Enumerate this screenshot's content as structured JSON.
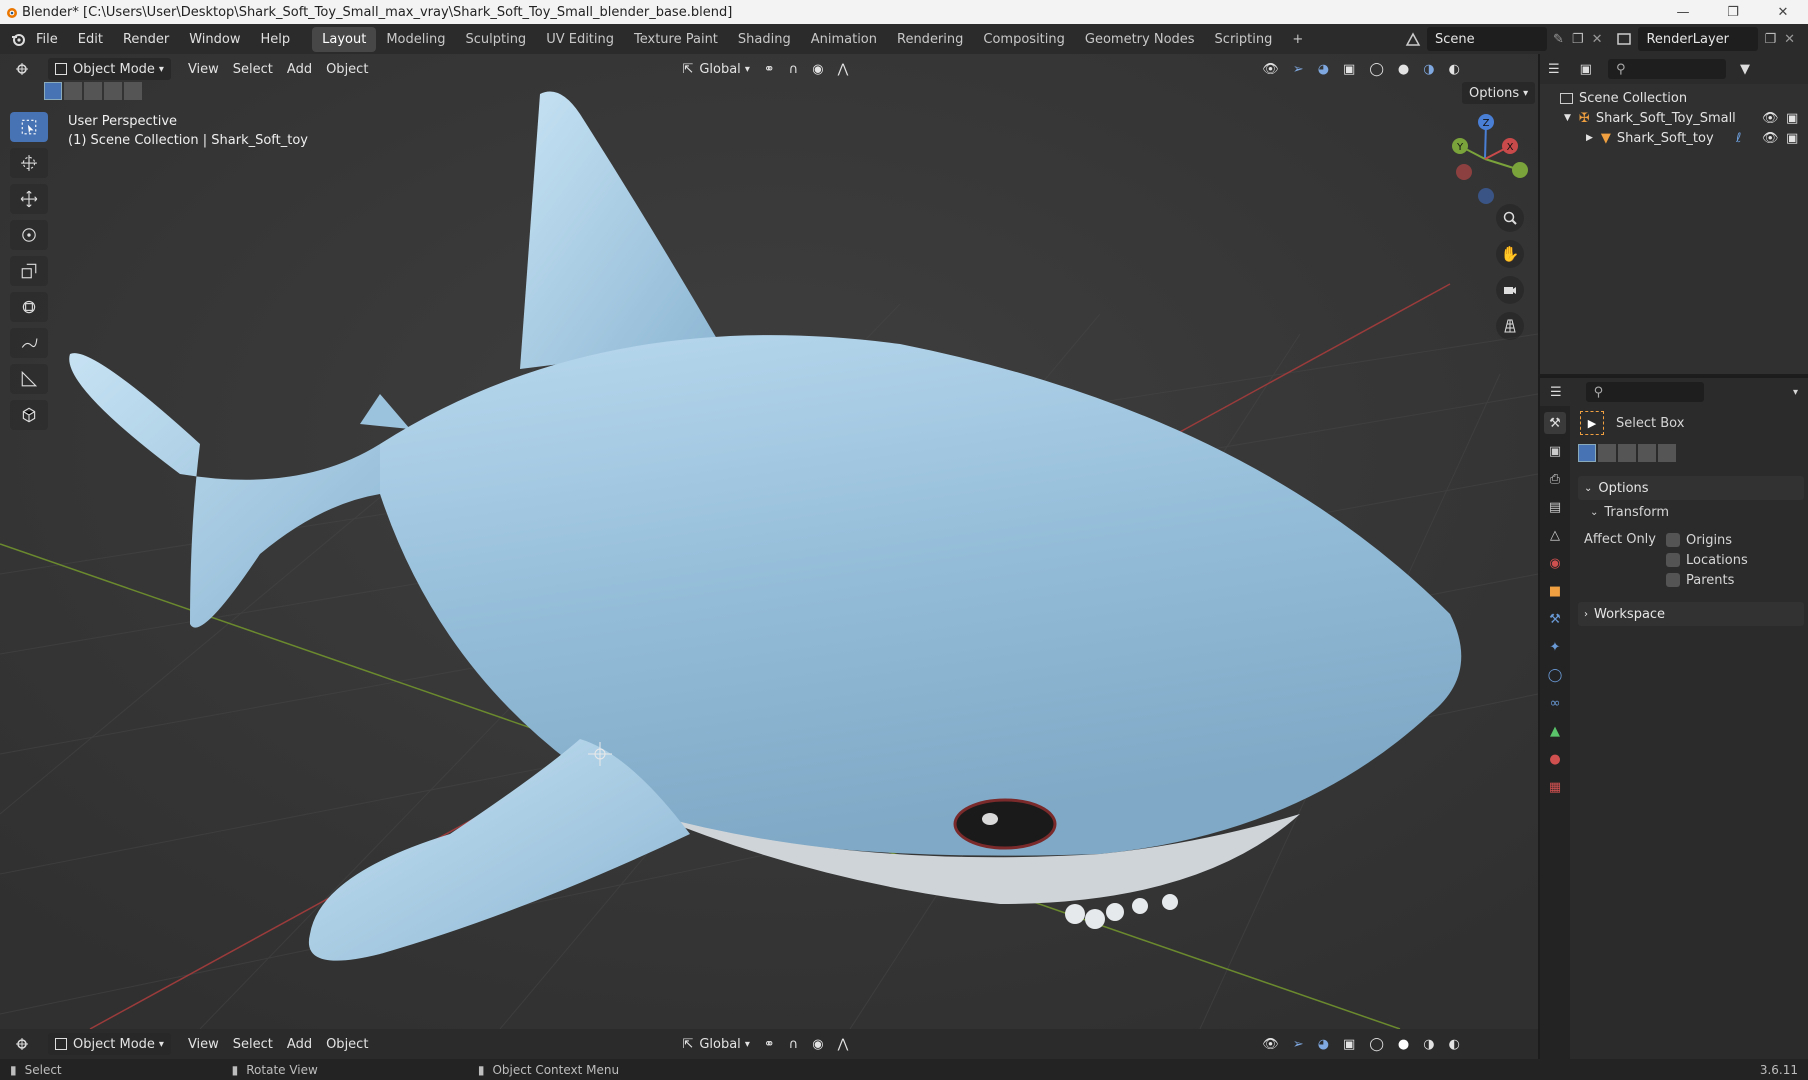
{
  "window": {
    "title": "Blender* [C:\\Users\\User\\Desktop\\Shark_Soft_Toy_Small_max_vray\\Shark_Soft_Toy_Small_blender_base.blend]"
  },
  "menu": {
    "items": [
      "File",
      "Edit",
      "Render",
      "Window",
      "Help"
    ]
  },
  "workspaces": {
    "tabs": [
      "Layout",
      "Modeling",
      "Sculpting",
      "UV Editing",
      "Texture Paint",
      "Shading",
      "Animation",
      "Rendering",
      "Compositing",
      "Geometry Nodes",
      "Scripting"
    ],
    "active": "Layout",
    "add_label": "+"
  },
  "scene": {
    "name": "Scene",
    "render_layer": "RenderLayer"
  },
  "viewport": {
    "mode": "Object Mode",
    "menus": [
      "View",
      "Select",
      "Add",
      "Object"
    ],
    "orientation": "Global",
    "options_label": "Options",
    "info_line1": "User Perspective",
    "info_line2": "(1) Scene Collection | Shark_Soft_toy",
    "gizmo": {
      "x": "X",
      "y": "Y",
      "z": "Z"
    }
  },
  "footer": {
    "mode": "Object Mode",
    "menus": [
      "View",
      "Select",
      "Add",
      "Object"
    ],
    "orientation": "Global"
  },
  "statusbar": {
    "select": "Select",
    "rotate": "Rotate View",
    "context": "Object Context Menu",
    "version": "3.6.11"
  },
  "outliner": {
    "root": "Scene Collection",
    "items": [
      {
        "name": "Shark_Soft_Toy_Small",
        "level": 1
      },
      {
        "name": "Shark_Soft_toy",
        "level": 2
      }
    ]
  },
  "properties": {
    "tool_name": "Select Box",
    "options_label": "Options",
    "transform_label": "Transform",
    "affect_only_label": "Affect Only",
    "checkboxes": [
      "Origins",
      "Locations",
      "Parents"
    ],
    "workspace_label": "Workspace"
  },
  "colors": {
    "accent": "#4772b3",
    "shark_body": "#a9cde6",
    "grid_x": "#9b3b3b",
    "grid_y": "#6b8a2e"
  }
}
